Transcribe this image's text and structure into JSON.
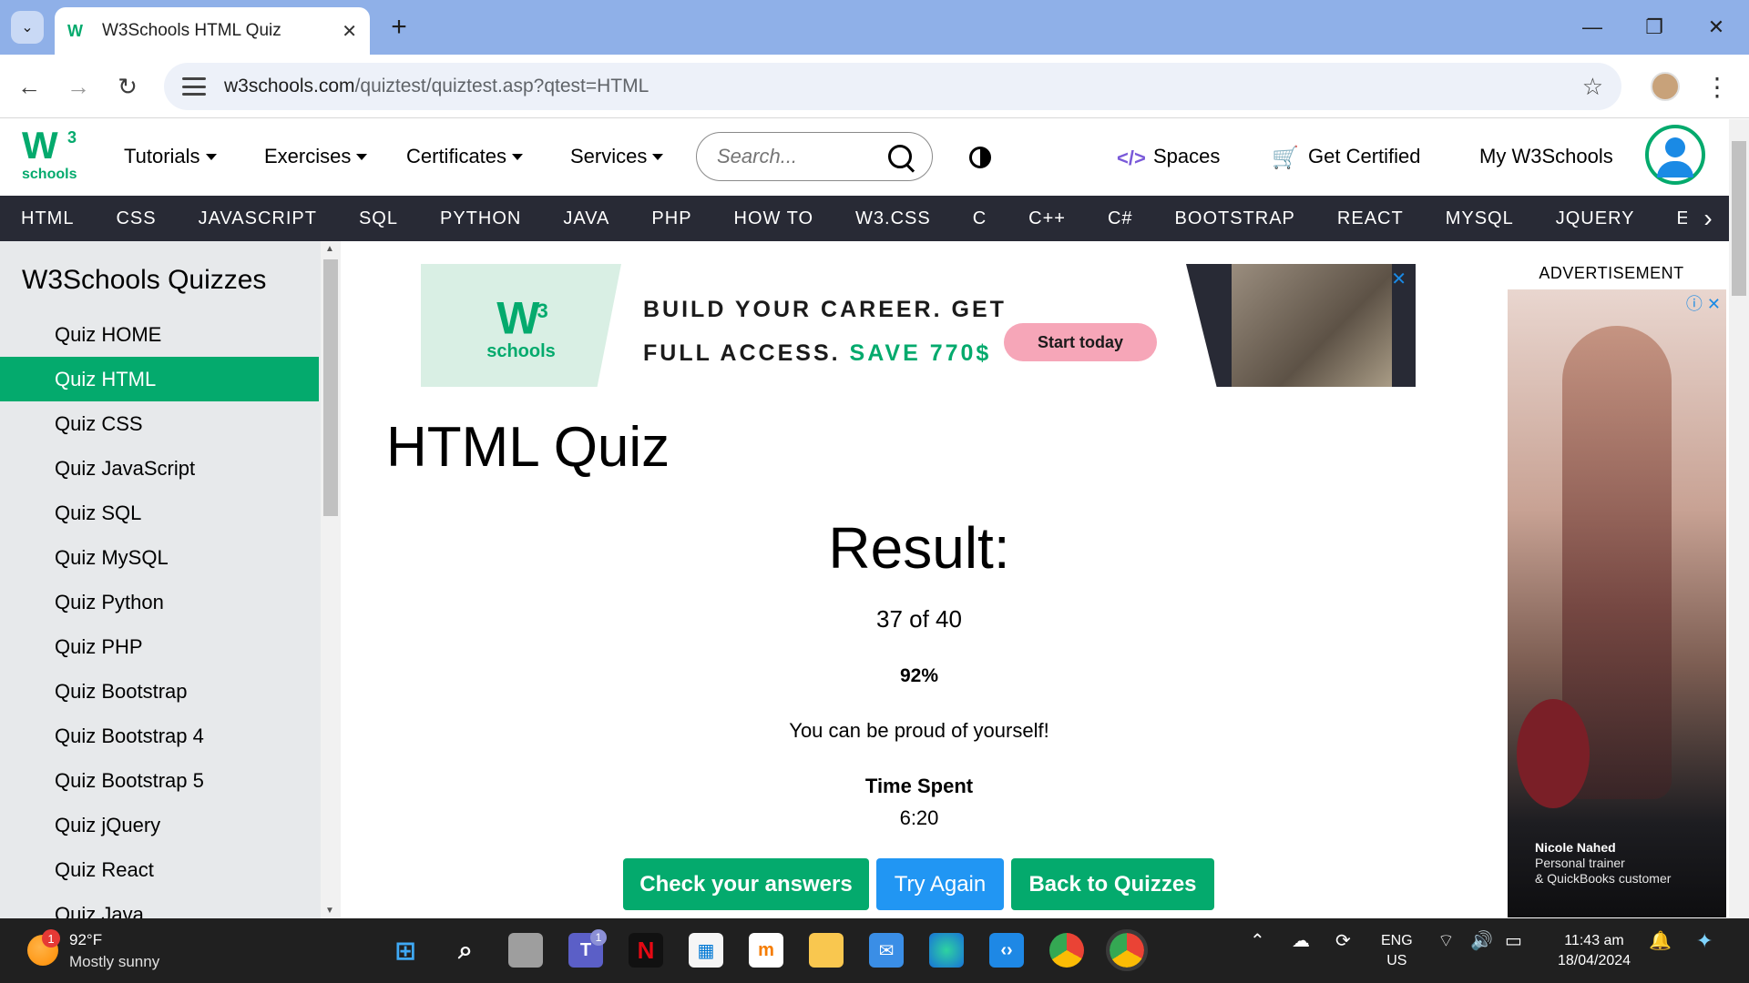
{
  "browser": {
    "tab_title": "W3Schools HTML Quiz",
    "url_host": "w3schools.com",
    "url_path": "/quiztest/quiztest.asp?qtest=HTML"
  },
  "topnav": {
    "logo_sup": "3",
    "logo_word": "schools",
    "tutorials": "Tutorials",
    "exercises": "Exercises",
    "certificates": "Certificates",
    "services": "Services",
    "search_placeholder": "Search...",
    "spaces": "Spaces",
    "get_certified": "Get Certified",
    "my_w3schools": "My W3Schools"
  },
  "langbar": [
    "HTML",
    "CSS",
    "JAVASCRIPT",
    "SQL",
    "PYTHON",
    "JAVA",
    "PHP",
    "HOW TO",
    "W3.CSS",
    "C",
    "C++",
    "C#",
    "BOOTSTRAP",
    "REACT",
    "MYSQL",
    "JQUERY",
    "EX"
  ],
  "sidebar": {
    "title": "W3Schools Quizzes",
    "items": [
      "Quiz HOME",
      "Quiz HTML",
      "Quiz CSS",
      "Quiz JavaScript",
      "Quiz SQL",
      "Quiz MySQL",
      "Quiz Python",
      "Quiz PHP",
      "Quiz Bootstrap",
      "Quiz Bootstrap 4",
      "Quiz Bootstrap 5",
      "Quiz jQuery",
      "Quiz React",
      "Quiz Java"
    ],
    "active_index": 1
  },
  "banner": {
    "logo_word": "schools",
    "logo_sup": "3",
    "line1": "BUILD YOUR CAREER. GET",
    "line2": "FULL ACCESS.",
    "save": "SAVE 770$",
    "cta": "Start today"
  },
  "main": {
    "title": "HTML Quiz",
    "result_heading": "Result:",
    "score": "37 of 40",
    "percent": "92%",
    "message": "You can be proud of yourself!",
    "time_label": "Time Spent",
    "time_value": "6:20",
    "btn_check": "Check your answers",
    "btn_try": "Try Again",
    "btn_back": "Back to Quizzes"
  },
  "ad": {
    "label": "ADVERTISEMENT",
    "name": "Nicole Nahed",
    "role": "Personal trainer",
    "customer": "& QuickBooks customer"
  },
  "taskbar": {
    "weather_badge": "1",
    "temp": "92°F",
    "condition": "Mostly sunny",
    "teams_badge": "1",
    "lang_top": "ENG",
    "lang_bottom": "US",
    "time": "11:43 am",
    "date": "18/04/2024"
  },
  "colors": {
    "w3_green": "#04aa6d",
    "langbar_bg": "#282a35",
    "sidebar_bg": "#e7e9eb",
    "try_again_blue": "#2196f3",
    "tabbar_bg": "#8fb0e8"
  }
}
